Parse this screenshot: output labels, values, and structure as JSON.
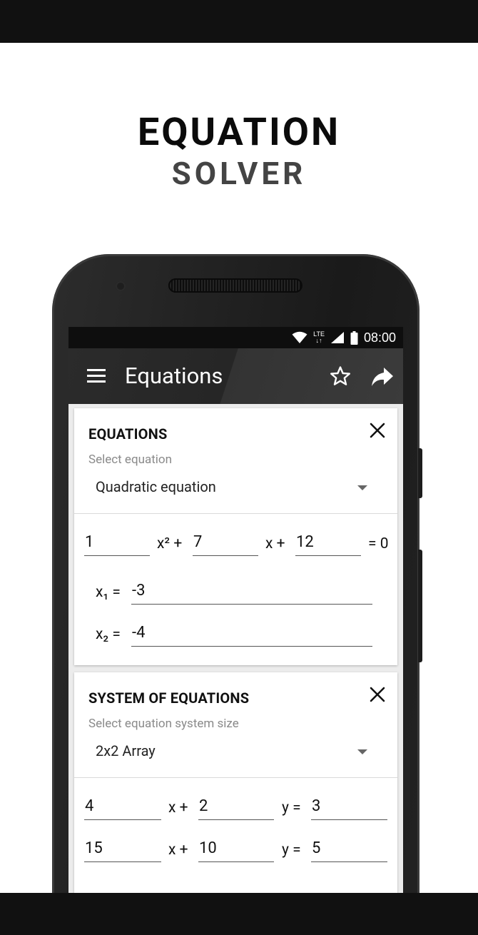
{
  "promo": {
    "line1": "EQUATION",
    "line2": "SOLVER"
  },
  "statusbar": {
    "network": "LTE",
    "time": "08:00"
  },
  "appbar": {
    "title": "Equations",
    "icons": [
      "menu-icon",
      "star-icon",
      "share-icon"
    ]
  },
  "equations_card": {
    "title": "EQUATIONS",
    "hint": "Select equation",
    "selected": "Quadratic equation",
    "coef_a": "1",
    "term_x2": "x² +",
    "coef_b": "7",
    "term_x": "x +",
    "coef_c": "12",
    "term_eq": "= 0",
    "x1_label": "x₁ =",
    "x1_value": "-3",
    "x2_label": "x₂ =",
    "x2_value": "-4"
  },
  "system_card": {
    "title": "SYSTEM OF EQUATIONS",
    "hint": "Select equation system size",
    "selected": "2x2 Array",
    "rows": [
      {
        "a": "4",
        "x_label": "x +",
        "b": "2",
        "y_label": "y =",
        "c": "3"
      },
      {
        "a": "15",
        "x_label": "x +",
        "b": "10",
        "y_label": "y =",
        "c": "5"
      }
    ]
  },
  "colors": {
    "frame_bar": "#111111",
    "appbar": "#2b2b2b",
    "screen_bg": "#ececec",
    "card": "#ffffff"
  }
}
